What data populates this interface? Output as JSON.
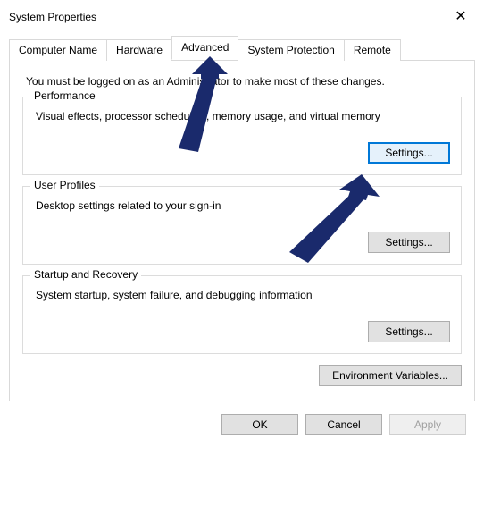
{
  "window": {
    "title": "System Properties",
    "close_glyph": "✕"
  },
  "tabs": [
    {
      "label": "Computer Name"
    },
    {
      "label": "Hardware"
    },
    {
      "label": "Advanced"
    },
    {
      "label": "System Protection"
    },
    {
      "label": "Remote"
    }
  ],
  "active_tab_index": 2,
  "advanced": {
    "intro": "You must be logged on as an Administrator to make most of these changes.",
    "performance": {
      "legend": "Performance",
      "desc": "Visual effects, processor scheduling, memory usage, and virtual memory",
      "button": "Settings..."
    },
    "user_profiles": {
      "legend": "User Profiles",
      "desc": "Desktop settings related to your sign-in",
      "button": "Settings..."
    },
    "startup": {
      "legend": "Startup and Recovery",
      "desc": "System startup, system failure, and debugging information",
      "button": "Settings..."
    },
    "env_button": "Environment Variables..."
  },
  "footer": {
    "ok": "OK",
    "cancel": "Cancel",
    "apply": "Apply"
  },
  "annotation": {
    "color": "#1a2a6c"
  }
}
